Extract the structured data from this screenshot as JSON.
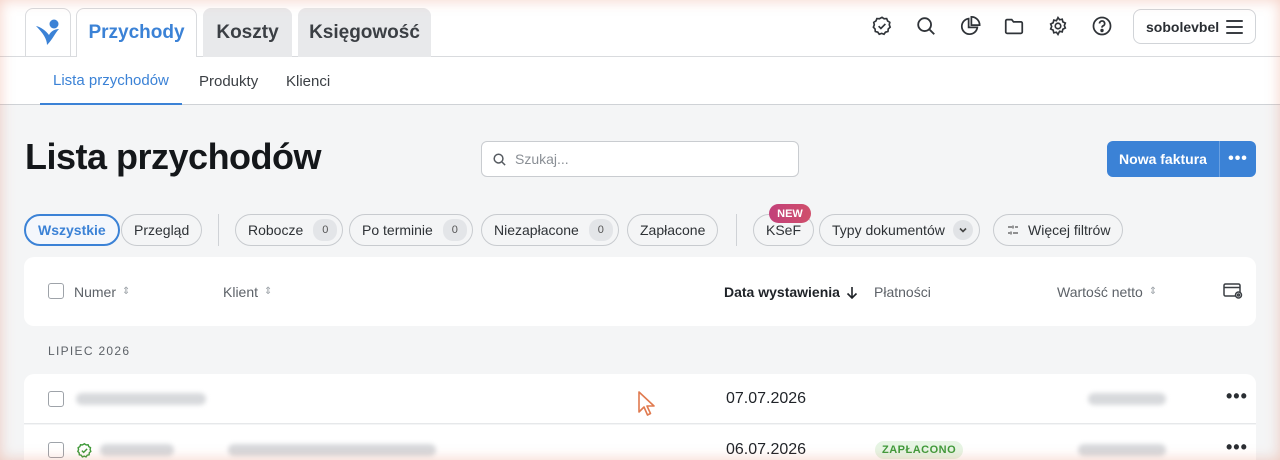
{
  "app": {
    "main_tabs": [
      {
        "label": "Przychody",
        "active": true
      },
      {
        "label": "Koszty",
        "active": false
      },
      {
        "label": "Księgowość",
        "active": false
      }
    ],
    "toolbar_icons": [
      "badge-check-icon",
      "search-icon",
      "pie-chart-icon",
      "folder-icon",
      "gear-icon",
      "help-icon"
    ],
    "user": {
      "name": "sobolevbel",
      "menu_icon": "hamburger-icon"
    },
    "accent": "#3b82d6"
  },
  "sub_tabs": [
    {
      "label": "Lista przychodów",
      "active": true
    },
    {
      "label": "Produkty",
      "active": false
    },
    {
      "label": "Klienci",
      "active": false
    }
  ],
  "page": {
    "title": "Lista przychodów",
    "search_placeholder": "Szukaj...",
    "new_invoice_label": "Nowa faktura",
    "more_label": "•••"
  },
  "filters": {
    "all": "Wszystkie",
    "overview": "Przegląd",
    "drafts": {
      "label": "Robocze",
      "count": "0"
    },
    "overdue": {
      "label": "Po terminie",
      "count": "0"
    },
    "unpaid": {
      "label": "Niezapłacone",
      "count": "0"
    },
    "paid": "Zapłacone",
    "ksef": "KSeF",
    "ksef_badge": "NEW",
    "doc_types": "Typy dokumentów",
    "more_filters": "Więcej filtrów"
  },
  "table": {
    "columns": {
      "number": "Numer",
      "client": "Klient",
      "issue_date": "Data wystawienia",
      "payments": "Płatności",
      "net_value": "Wartość netto"
    },
    "group_label": "LIPIEC 2026",
    "rows": [
      {
        "date": "07.07.2026",
        "status": ""
      },
      {
        "date": "06.07.2026",
        "status": "ZAPŁACONO"
      }
    ]
  }
}
